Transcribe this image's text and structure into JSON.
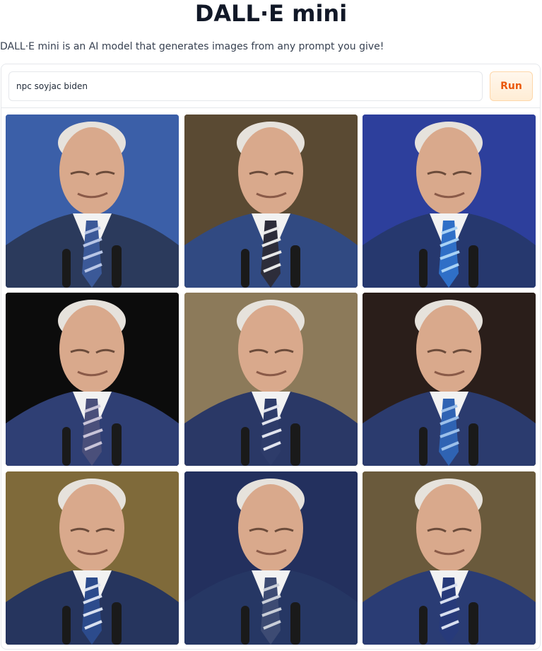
{
  "header": {
    "title": "DALL·E mini",
    "subtitle": "DALL·E mini is an AI model that generates images from any prompt you give!"
  },
  "prompt": {
    "value": "npc soyjac biden",
    "run_label": "Run"
  },
  "results": [
    {
      "background": "#3b5fa8",
      "suit": "#2b3a5c",
      "tie": "#3b5998",
      "tie_stripe": "#b8c6e6"
    },
    {
      "background": "#5a4a33",
      "suit": "#314a82",
      "tie": "#2d2d3a",
      "tie_stripe": "#e8e8e8"
    },
    {
      "background": "#2d3f9c",
      "suit": "#26386e",
      "tie": "#2f6fc7",
      "tie_stripe": "#a9d2f5"
    },
    {
      "background": "#0c0c0c",
      "suit": "#2f3f74",
      "tie": "#4a4f7a",
      "tie_stripe": "#c9c4d8"
    },
    {
      "background": "#8c7a5a",
      "suit": "#2a3866",
      "tie": "#2e3c6a",
      "tie_stripe": "#e1e4ee"
    },
    {
      "background": "#2a1e1a",
      "suit": "#2b3b6e",
      "tie": "#2f63b3",
      "tie_stripe": "#9cc0ea"
    },
    {
      "background": "#7f6a3a",
      "suit": "#26355e",
      "tie": "#2c4b8c",
      "tie_stripe": "#d8e0f0"
    },
    {
      "background": "#23305e",
      "suit": "#263764",
      "tie": "#3d4b73",
      "tie_stripe": "#c9ced8"
    },
    {
      "background": "#6a5a3c",
      "suit": "#2a3c74",
      "tie": "#273a7a",
      "tie_stripe": "#d8dff0"
    }
  ]
}
